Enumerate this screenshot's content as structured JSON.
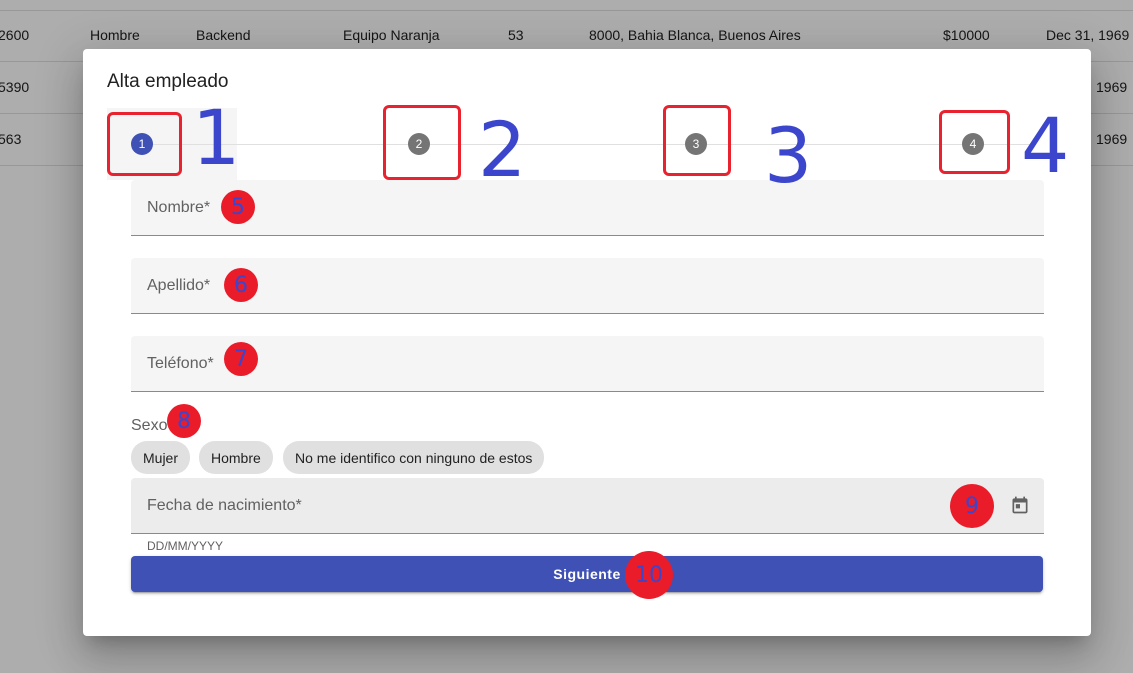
{
  "background_table": {
    "rows": [
      [
        "2600",
        "Hombre",
        "Backend",
        "Equipo Naranja",
        "53",
        "8000, Bahia Blanca, Buenos Aires",
        "$10000",
        "Dec 31, 1969"
      ],
      [
        "5390",
        "",
        "",
        "",
        "",
        "",
        "",
        "1969"
      ],
      [
        "563",
        "",
        "",
        "",
        "",
        "",
        "",
        "1969"
      ]
    ]
  },
  "dialog": {
    "title": "Alta empleado",
    "steps": [
      "1",
      "2",
      "3",
      "4"
    ],
    "fields": {
      "nombre": "Nombre*",
      "apellido": "Apellido*",
      "telefono": "Teléfono*",
      "fecha": "Fecha de nacimiento*",
      "fecha_hint": "DD/MM/YYYY"
    },
    "sexo_label": "Sexo",
    "sexo_options": [
      "Mujer",
      "Hombre",
      "No me identifico con ninguno de estos"
    ],
    "next_button": "Siguiente"
  },
  "annotations": {
    "big_numbers": [
      "1",
      "2",
      "3",
      "4"
    ],
    "dots": [
      "5",
      "6",
      "7",
      "8",
      "9",
      "10"
    ]
  },
  "colors": {
    "primary": "#3f51b5",
    "annotation_red": "#e8232f",
    "annotation_blue": "#3b46cc"
  },
  "icons": {
    "date_picker": "calendar-icon"
  }
}
